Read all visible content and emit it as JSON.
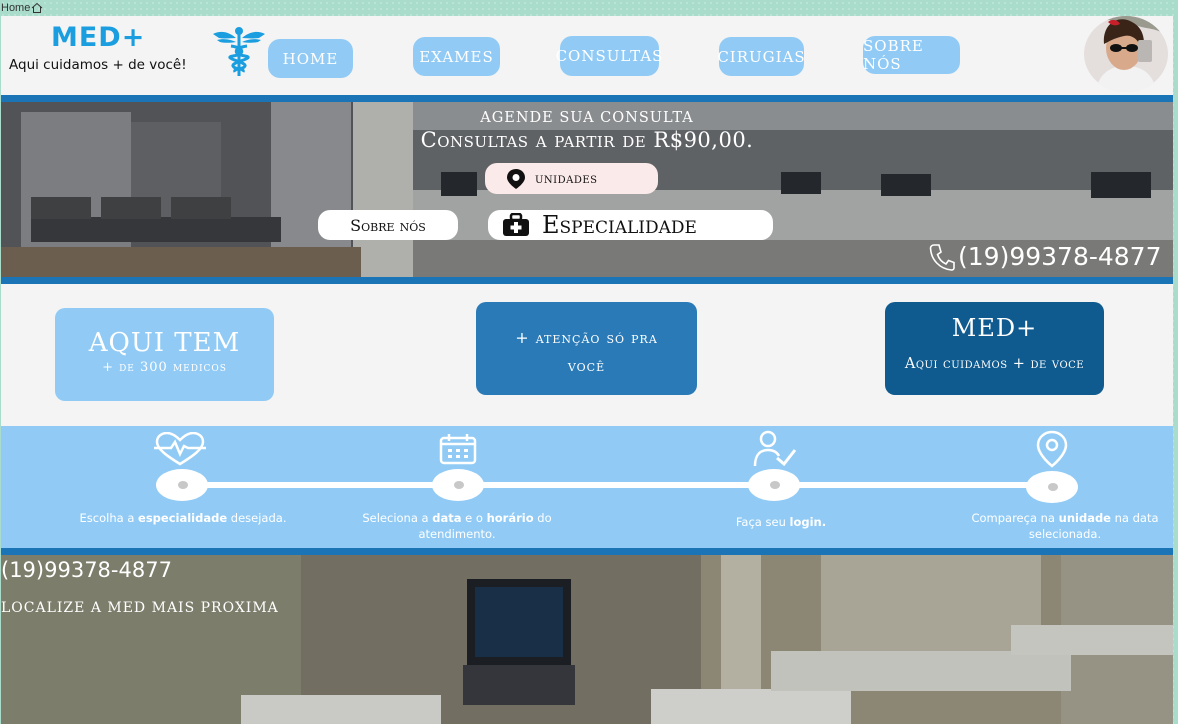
{
  "breadcrumb": {
    "label": "Home"
  },
  "header": {
    "logo_title": "MED+",
    "logo_subtitle": "Aqui cuidamos + de você!",
    "nav": [
      {
        "label": "HOME"
      },
      {
        "label": "EXAMES"
      },
      {
        "label": "CONSULTAS"
      },
      {
        "label": "CIRUGIAS"
      },
      {
        "label": "SOBRE NÓS"
      }
    ]
  },
  "hero": {
    "line1": "AGENDE SUA CONSULTA",
    "line2": "Consultas a partir de R$90,00.",
    "unidades_label": "unidades",
    "sobre_label": "Sobre nós",
    "especialidade_label": "Especialidade",
    "phone": "(19)99378-4877"
  },
  "promo": {
    "card1_title": "AQUI TEM",
    "card1_sub": "+ de 300 medicos",
    "card2_text": "+ atenção só pra você",
    "card3_title": "MED+",
    "card3_sub": "Aqui cuidamos + de voce"
  },
  "steps": [
    {
      "pre": "Escolha a ",
      "b1": "especialidade",
      "mid": " desejada.",
      "b2": "",
      "post": "",
      "line2": ""
    },
    {
      "pre": "Seleciona a ",
      "b1": "data",
      "mid": " e o ",
      "b2": "horário",
      "post": " do",
      "line2": "atendimento."
    },
    {
      "pre": "Faça seu ",
      "b1": "login.",
      "mid": "",
      "b2": "",
      "post": "",
      "line2": ""
    },
    {
      "pre": "Compareça na ",
      "b1": "unidade",
      "mid": " na data",
      "b2": "",
      "post": "",
      "line2": "selecionada."
    }
  ],
  "bottom": {
    "phone": "(19)99378-4877",
    "locate": "LOCALIZE A MED MAIS PROXIMA"
  },
  "colors": {
    "accent_light": "#91cbf5",
    "accent_mid": "#2a7ab8",
    "accent_dark": "#0f5a8e",
    "stripe": "#1a74b6",
    "logo": "#1a9ee0"
  }
}
